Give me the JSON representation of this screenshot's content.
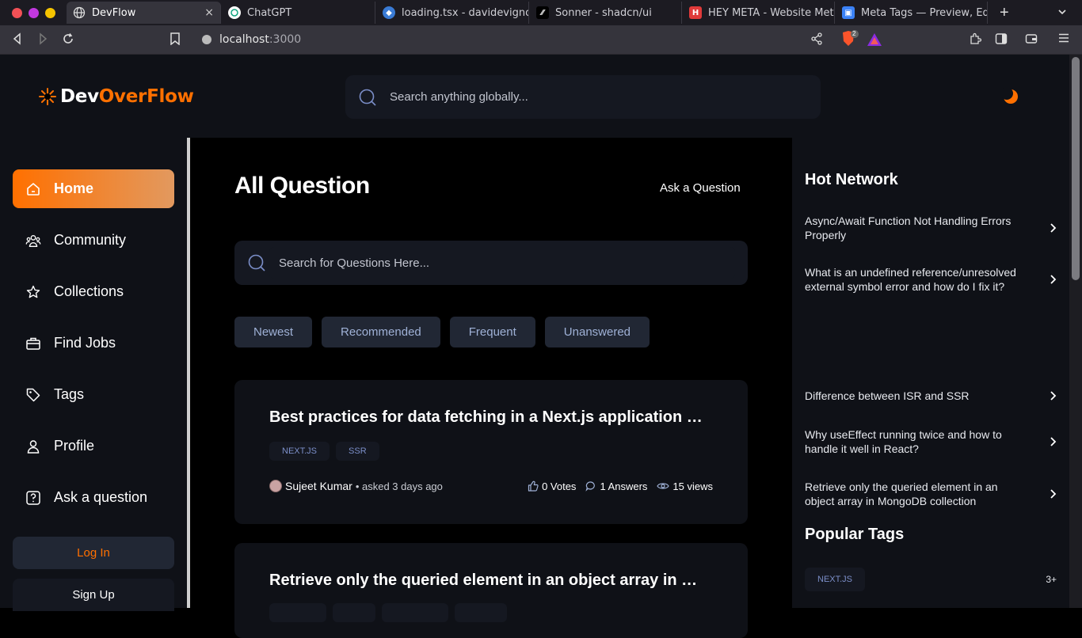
{
  "browser": {
    "tabs": [
      {
        "title": "DevFlow",
        "active": true
      },
      {
        "title": "ChatGPT"
      },
      {
        "title": "loading.tsx - davidevignoz"
      },
      {
        "title": "Sonner - shadcn/ui"
      },
      {
        "title": "HEY META - Website Meta T"
      },
      {
        "title": "Meta Tags — Preview, Edit a"
      }
    ],
    "new_tab": "+",
    "close": "×",
    "url_host": "localhost",
    "url_port": ":3000",
    "shield_count": "2"
  },
  "app": {
    "logo": {
      "dev": "Dev",
      "overflow": "OverFlow"
    },
    "global_search_placeholder": "Search anything globally...",
    "sidebar": {
      "items": [
        {
          "label": "Home",
          "icon": "home-icon"
        },
        {
          "label": "Community",
          "icon": "users-icon"
        },
        {
          "label": "Collections",
          "icon": "star-icon"
        },
        {
          "label": "Find Jobs",
          "icon": "briefcase-icon"
        },
        {
          "label": "Tags",
          "icon": "tag-icon"
        },
        {
          "label": "Profile",
          "icon": "user-icon"
        },
        {
          "label": "Ask a question",
          "icon": "question-icon"
        }
      ],
      "login": "Log In",
      "signup": "Sign Up"
    },
    "main": {
      "title": "All Question",
      "ask_button": "Ask a Question",
      "search_placeholder": "Search for Questions Here...",
      "filters": [
        "Newest",
        "Recommended",
        "Frequent",
        "Unanswered"
      ],
      "questions": [
        {
          "title": "Best practices for data fetching in a Next.js application with Server-Side Rendering (SSR)?",
          "tags": [
            "NEXT.JS",
            "SSR"
          ],
          "author": "Sujeet Kumar",
          "asked": "• asked 3 days ago",
          "votes": "0 Votes",
          "answers": "1 Answers",
          "views": "15 views"
        },
        {
          "title": "Retrieve only the queried element in an object array in MongoDB collection"
        }
      ]
    },
    "rightbar": {
      "hot_title": "Hot Network",
      "hot_items": [
        "Async/Await Function Not Handling Errors Properly",
        "What is an undefined reference/unresolved external symbol error and how do I fix it?",
        "Difference between ISR and SSR",
        "Why useEffect running twice and how to handle it well in React?",
        "Retrieve only the queried element in an object array in MongoDB collection"
      ],
      "tags_title": "Popular Tags",
      "tags": [
        {
          "name": "NEXT.JS",
          "count": "3+"
        }
      ]
    },
    "colors": {
      "accent": "#ff7000",
      "panel": "#0f1117",
      "card": "#151821"
    }
  }
}
